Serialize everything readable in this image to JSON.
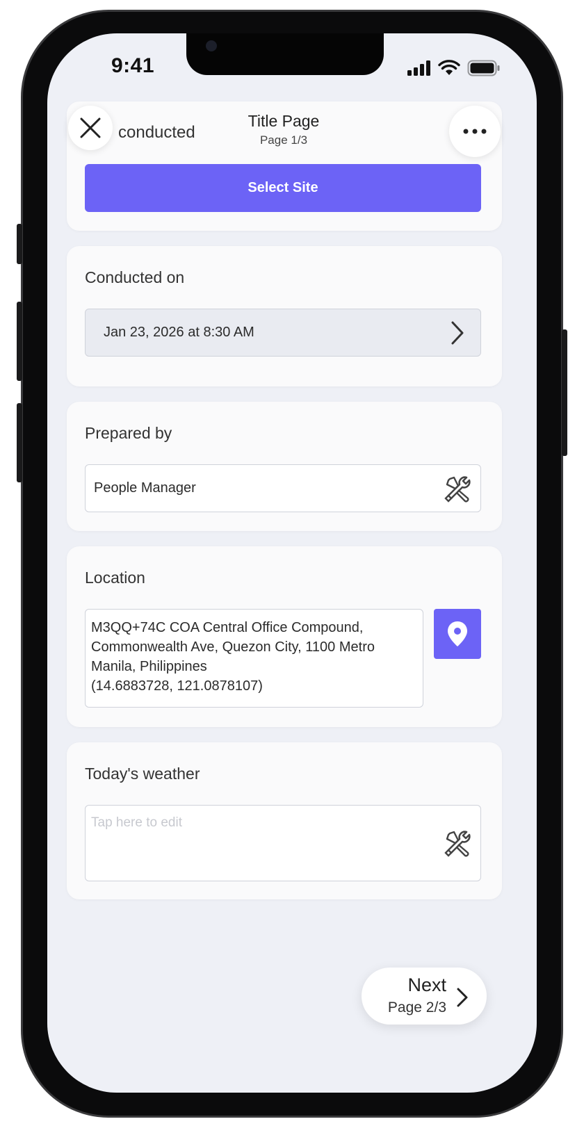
{
  "status_bar": {
    "time": "9:41"
  },
  "header": {
    "title": "Title Page",
    "subtitle": "Page 1/3",
    "scrolled_text": "conducted",
    "close_icon": "close-icon",
    "more_icon": "more-horizontal-icon"
  },
  "site": {
    "button_label": "Select Site"
  },
  "conducted": {
    "label": "Conducted on",
    "value": "Jan 23, 2026 at 8:30 AM",
    "icon": "chevron-right-icon"
  },
  "prepared": {
    "label": "Prepared by",
    "value": "People Manager",
    "icon": "tools-icon"
  },
  "location": {
    "label": "Location",
    "address_lines": [
      "M3QQ+74C COA Central Office Compound,",
      "Commonwealth Ave, Quezon City, 1100 Metro",
      "Manila, Philippines",
      "(14.6883728, 121.0878107)"
    ],
    "icon": "map-pin-icon"
  },
  "weather": {
    "label": "Today's weather",
    "placeholder": "Tap here to edit",
    "icon": "tools-icon"
  },
  "footer": {
    "next_label": "Next",
    "next_sub": "Page 2/3",
    "icon": "chevron-right-icon"
  },
  "colors": {
    "accent": "#6c63f6",
    "background": "#eef0f6",
    "card": "#fafafb"
  }
}
